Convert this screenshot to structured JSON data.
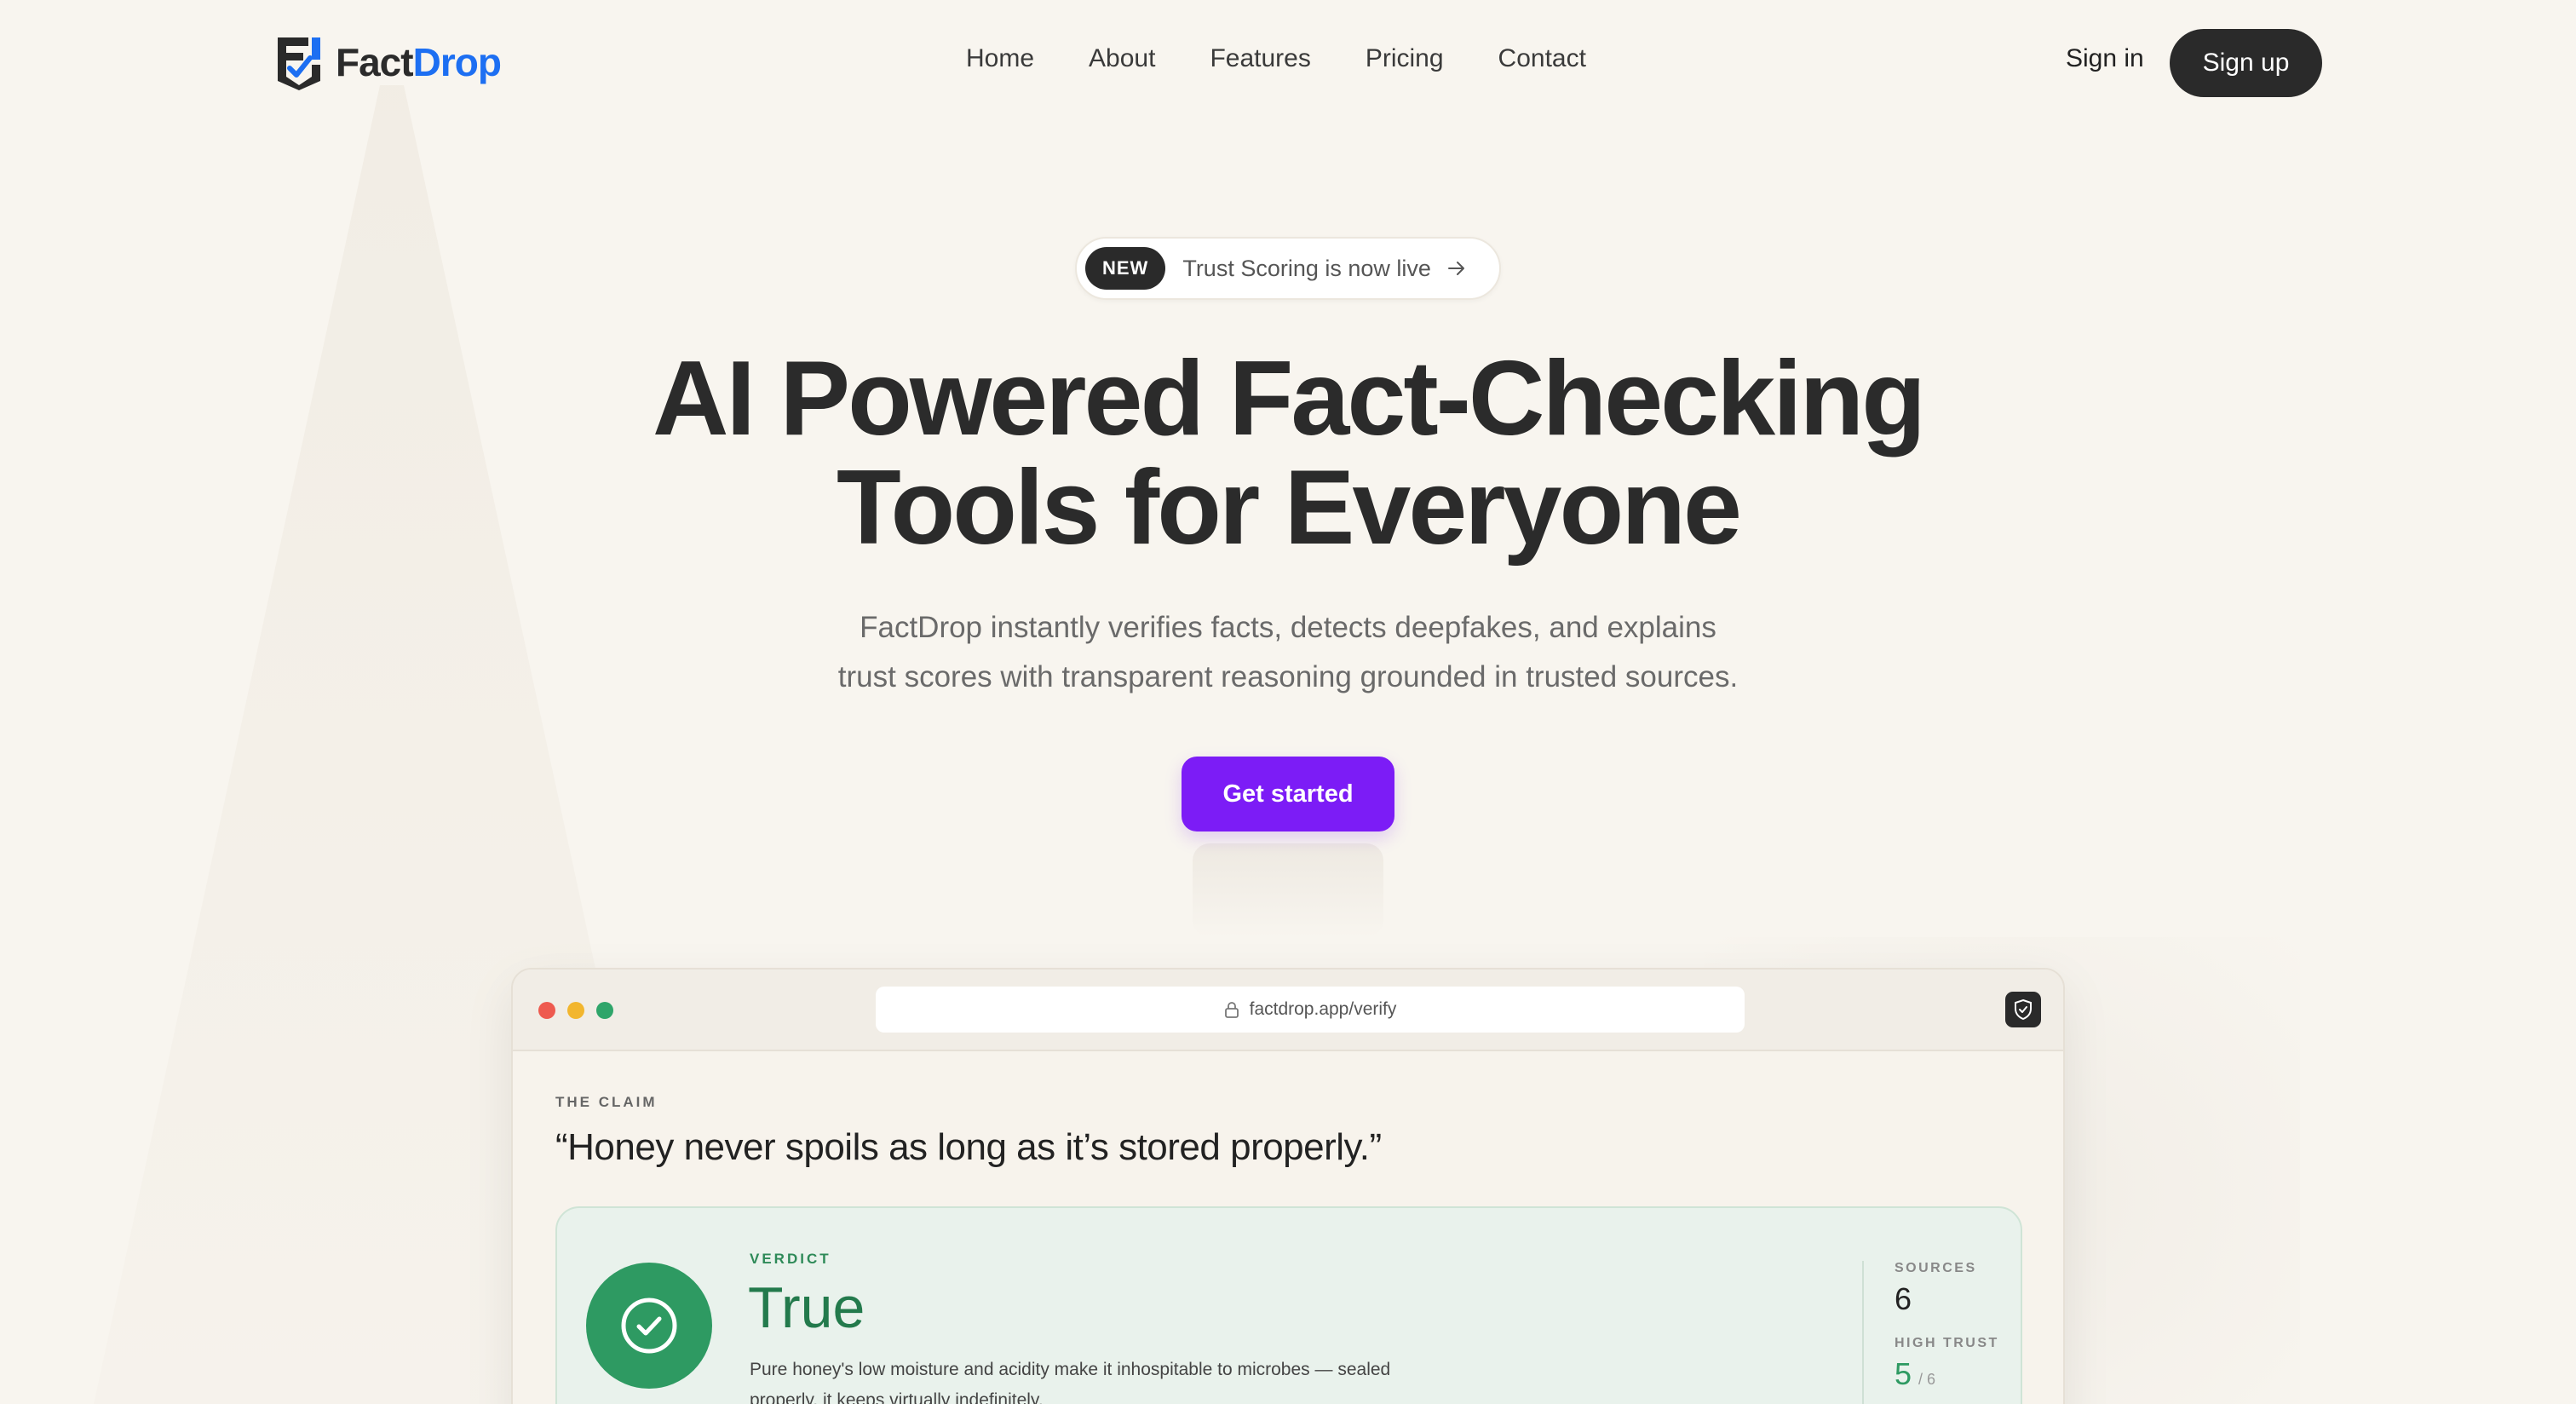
{
  "brand": {
    "name_part1": "Fact",
    "name_part2": "Drop",
    "accent": "#1d6ff2"
  },
  "nav": {
    "links": [
      "Home",
      "About",
      "Features",
      "Pricing",
      "Contact"
    ],
    "signin": "Sign in",
    "signup": "Sign up"
  },
  "announcement": {
    "badge": "NEW",
    "text": "Trust Scoring is now live",
    "arrow_icon": "arrow-right-icon"
  },
  "hero": {
    "title_line1": "AI Powered Fact-Checking",
    "title_line2": "Tools for Everyone",
    "subtitle_line1": "FactDrop instantly verifies facts, detects deepfakes, and explains",
    "subtitle_line2": "trust scores with transparent reasoning grounded in trusted sources.",
    "cta": "Get started",
    "cta_color": "#7c1cf6"
  },
  "browser": {
    "url": "factdrop.app/verify",
    "claim_label": "THE CLAIM",
    "claim_text": "“Honey never spoils as long as it’s stored properly.”",
    "verdict": {
      "label": "VERDICT",
      "value": "True",
      "description": "Pure honey's low moisture and acidity make it inhospitable to microbes — sealed properly, it keeps virtually indefinitely.",
      "color": "#2e9a62"
    },
    "stats": {
      "sources_label": "SOURCES",
      "sources_value": "6",
      "high_trust_label": "HIGH TRUST",
      "high_trust_value": "5",
      "high_trust_of": "/ 6"
    }
  }
}
